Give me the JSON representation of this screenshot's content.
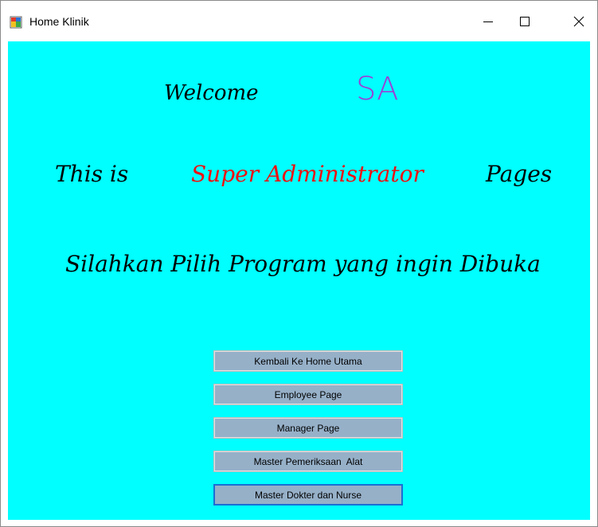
{
  "window": {
    "title": "Home Klinik",
    "icon": "form-app-icon"
  },
  "welcome": {
    "greeting": "Welcome",
    "user_code": "SA"
  },
  "headline": {
    "prefix": "This is",
    "role": "Super Administrator",
    "suffix": "Pages"
  },
  "prompt": "Silahkan Pilih Program yang ingin Dibuka",
  "buttons": [
    {
      "label": "Kembali Ke Home Utama",
      "focused": false
    },
    {
      "label": "Employee Page",
      "focused": false
    },
    {
      "label": "Manager Page",
      "focused": false
    },
    {
      "label": "Master Pemeriksaan  Alat",
      "focused": false
    },
    {
      "label": "Master Dokter dan Nurse",
      "focused": true
    }
  ],
  "colors": {
    "background": "#00ffff",
    "user_code": "#9b3fd6",
    "role": "#ee1010",
    "button_face": "#96b0c8",
    "focus_border": "#1a6fd4"
  }
}
